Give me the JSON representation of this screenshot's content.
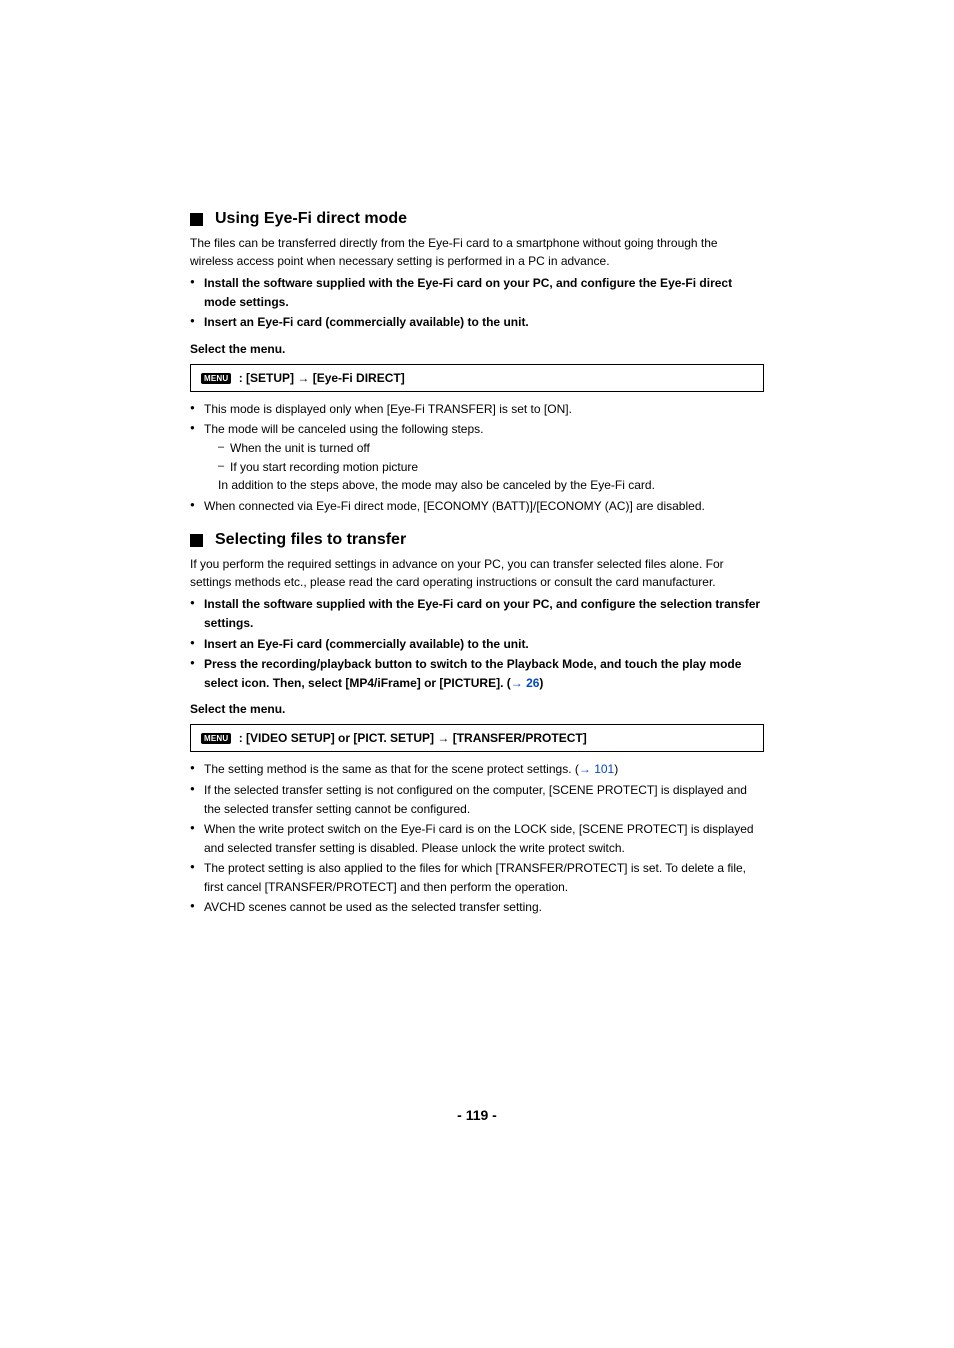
{
  "section1": {
    "title": "Using Eye-Fi direct mode",
    "intro": "The files can be transferred directly from the Eye-Fi card to a smartphone without going through the wireless access point when necessary setting is performed in a PC in advance.",
    "bul1": "Install the software supplied with the Eye-Fi card on your PC, and configure the Eye-Fi direct mode settings.",
    "bul2": "Insert an Eye-Fi card (commercially available) to the unit.",
    "select": "Select the menu.",
    "menuBadge": "MENU",
    "menuText1": ": [SETUP] ",
    "menuArrow": "→",
    "menuText2": " [Eye-Fi DIRECT]",
    "note1": "This mode is displayed only when [Eye-Fi TRANSFER] is set to [ON].",
    "note2": "The mode will be canceled using the following steps.",
    "sub1": "When the unit is turned off",
    "sub2": "If you start recording motion picture",
    "sub3": "In addition to the steps above, the mode may also be canceled by the Eye-Fi card.",
    "note3": "When connected via Eye-Fi direct mode, [ECONOMY (BATT)]/[ECONOMY (AC)] are disabled."
  },
  "section2": {
    "title": "Selecting files to transfer",
    "intro": "If you perform the required settings in advance on your PC, you can transfer selected files alone. For settings methods etc., please read the card operating instructions or consult the card manufacturer.",
    "bul1": "Install the software supplied with the Eye-Fi card on your PC, and configure the selection transfer settings.",
    "bul2": "Insert an Eye-Fi card (commercially available) to the unit.",
    "bul3a": "Press the recording/playback button to switch to the Playback Mode, and touch the play mode select icon. Then, select [MP4/iFrame] or [PICTURE]. (",
    "bul3arrow": "→",
    "bul3link": " 26",
    "bul3b": ")",
    "select": "Select the menu.",
    "menuBadge": "MENU",
    "menuText1": ": [VIDEO SETUP] or [PICT. SETUP] ",
    "menuArrow": "→",
    "menuText2": " [TRANSFER/PROTECT]",
    "note1a": "The setting method is the same as that for the scene protect settings. (",
    "note1arrow": "→",
    "note1link": " 101",
    "note1b": ")",
    "note2": "If the selected transfer setting is not configured on the computer, [SCENE PROTECT] is displayed and the selected transfer setting cannot be configured.",
    "note3": "When the write protect switch on the Eye-Fi card is on the LOCK side, [SCENE PROTECT] is displayed and selected transfer setting is disabled. Please unlock the write protect switch.",
    "note4": "The protect setting is also applied to the files for which [TRANSFER/PROTECT] is set. To delete a file, first cancel [TRANSFER/PROTECT] and then perform the operation.",
    "note5": "AVCHD scenes cannot be used as the selected transfer setting."
  },
  "pageNumber": "- 119 -"
}
